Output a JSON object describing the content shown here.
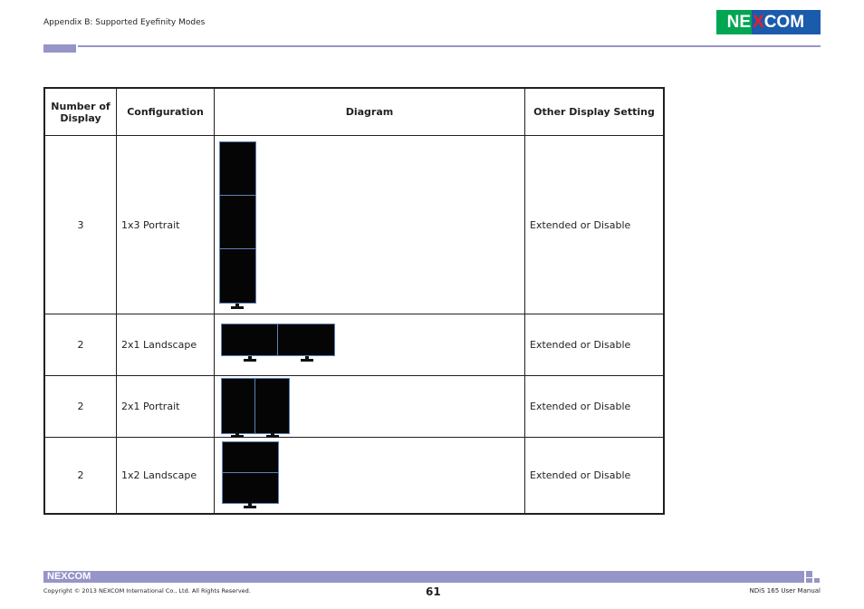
{
  "header": {
    "section_title": "Appendix B: Supported Eyefinity Modes",
    "logo": {
      "left": "NE",
      "mark": "X",
      "right": "COM",
      "green": "#00a651",
      "blue": "#1b5bab",
      "accent": "#ed1c24"
    }
  },
  "table": {
    "columns": [
      "Number of Display",
      "Configuration",
      "Diagram",
      "Other Display Setting"
    ],
    "rows": [
      {
        "count": "3",
        "configuration": "1x3 Portrait",
        "diagram": "three-portrait-monitors-stacked-vertically",
        "setting": "Extended or Disable"
      },
      {
        "count": "2",
        "configuration": "2x1 Landscape",
        "diagram": "two-landscape-monitors-side-by-side",
        "setting": "Extended or Disable"
      },
      {
        "count": "2",
        "configuration": "2x1 Portrait",
        "diagram": "two-portrait-monitors-side-by-side",
        "setting": "Extended or Disable"
      },
      {
        "count": "2",
        "configuration": "1x2 Landscape",
        "diagram": "two-landscape-monitors-stacked",
        "setting": "Extended or Disable"
      }
    ]
  },
  "footer": {
    "logo_text": "NEXCOM",
    "copyright": "Copyright © 2013 NEXCOM International Co., Ltd. All Rights Reserved.",
    "page_number": "61",
    "manual_title": "NDiS 165 User Manual",
    "bar_color": "#9695c8"
  }
}
